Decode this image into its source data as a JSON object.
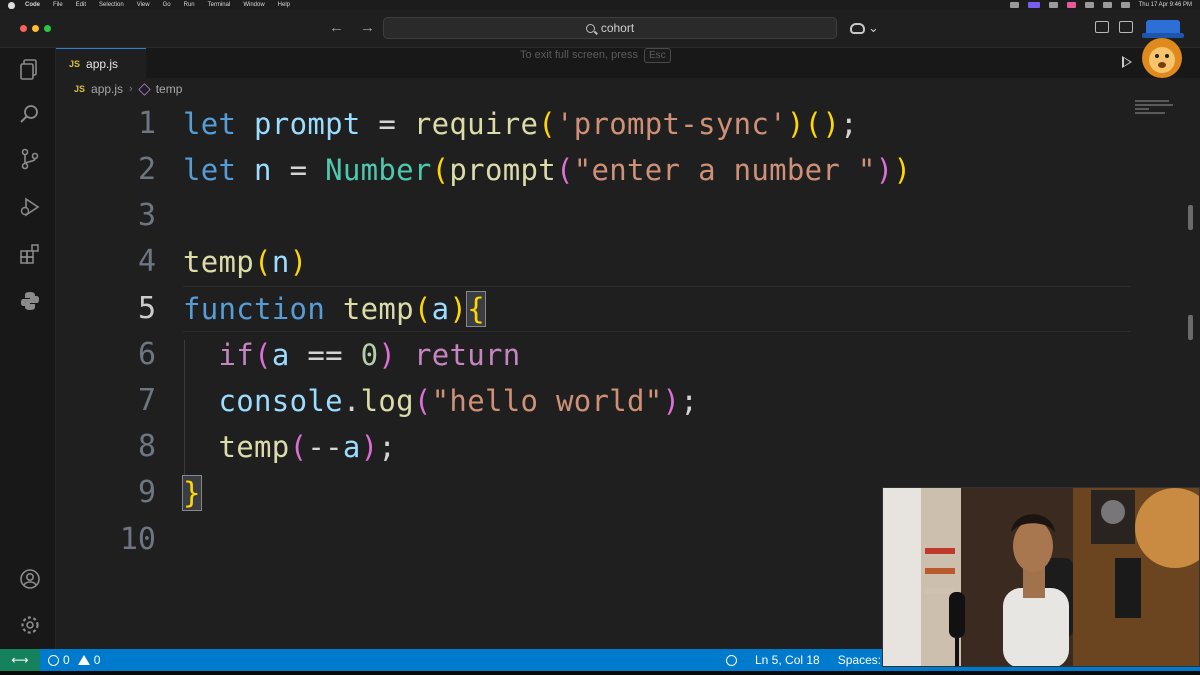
{
  "menubar": {
    "app": "Code",
    "items": [
      "File",
      "Edit",
      "Selection",
      "View",
      "Go",
      "Run",
      "Terminal",
      "Window",
      "Help"
    ],
    "datetime": "Thu 17 Apr  9:46 PM"
  },
  "titlebar": {
    "search_text": "cohort",
    "fullscreen_hint": "To exit full screen, press",
    "fullscreen_key": "Esc"
  },
  "tab": {
    "icon": "JS",
    "label": "app.js"
  },
  "breadcrumb": {
    "icon": "JS",
    "file": "app.js",
    "symbol": "temp"
  },
  "editor": {
    "line_numbers": [
      "1",
      "2",
      "3",
      "4",
      "5",
      "6",
      "7",
      "8",
      "9",
      "10"
    ],
    "active_line": 5,
    "lines": [
      "let prompt = require('prompt-sync')();",
      "let n = Number(prompt(\"enter a number \"))",
      "",
      "temp(n)",
      "function temp(a){",
      "  if(a == 0) return",
      "  console.log(\"hello world\");",
      "  temp(--a);",
      "}",
      ""
    ]
  },
  "statusbar": {
    "errors": "0",
    "warnings": "0",
    "position": "Ln 5, Col 18",
    "spaces": "Spaces:"
  },
  "colors": {
    "statusbar": "#007acc",
    "editor_bg": "#1f1f1f",
    "keyword": "#569cd6",
    "function": "#dcdcaa",
    "string": "#ce9178"
  }
}
